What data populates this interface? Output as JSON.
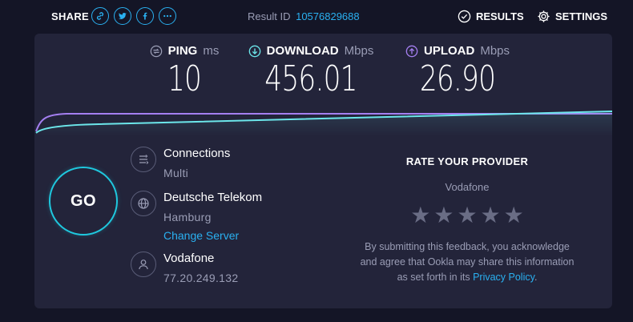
{
  "share": {
    "label": "SHARE",
    "icons": [
      "link-icon",
      "twitter-icon",
      "facebook-icon",
      "more-icon"
    ]
  },
  "result": {
    "label": "Result ID",
    "id": "10576829688"
  },
  "nav": {
    "results": "RESULTS",
    "settings": "SETTINGS"
  },
  "metrics": {
    "ping": {
      "label": "PING",
      "unit": "ms",
      "value": "10"
    },
    "download": {
      "label": "DOWNLOAD",
      "unit": "Mbps",
      "value": "456.01"
    },
    "upload": {
      "label": "UPLOAD",
      "unit": "Mbps",
      "value": "26.90"
    }
  },
  "colors": {
    "accent": "#2ab0f0",
    "go_ring": "#1fc8de",
    "download_line": "#6ce6ea",
    "upload_line": "#a47ff0",
    "panel_bg": "#23243a",
    "page_bg": "#141526"
  },
  "go": {
    "label": "GO"
  },
  "connection": {
    "title": "Connections",
    "mode": "Multi",
    "server_name": "Deutsche Telekom",
    "server_city": "Hamburg",
    "change_server": "Change Server",
    "provider": "Vodafone",
    "ip": "77.20.249.132"
  },
  "rate": {
    "title": "RATE YOUR PROVIDER",
    "provider": "Vodafone",
    "stars_total": 5,
    "stars_selected": 0,
    "disclaimer_1": "By submitting this feedback, you acknowledge",
    "disclaimer_2": "and agree that Ookla may share this information",
    "disclaimer_3_prefix": "as set forth in its",
    "privacy_link": "Privacy Policy",
    "disclaimer_3_suffix": "."
  }
}
